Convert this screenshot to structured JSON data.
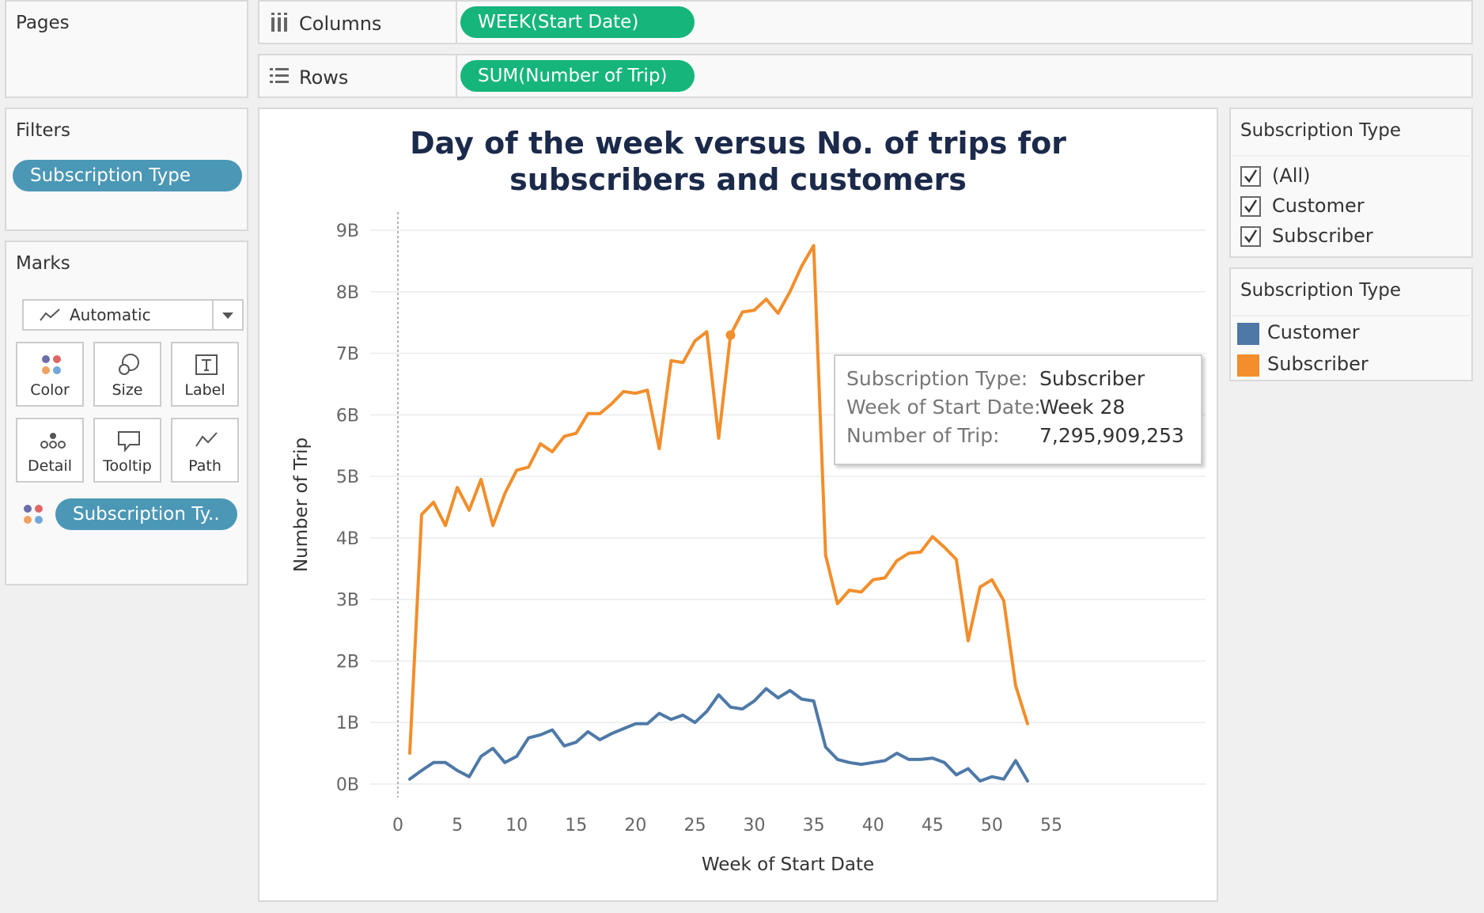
{
  "shelves": {
    "pages_label": "Pages",
    "columns_label": "Columns",
    "columns_pill": "WEEK(Start Date)",
    "rows_label": "Rows",
    "rows_pill": "SUM(Number of Trip)"
  },
  "filters": {
    "title": "Filters",
    "pill": "Subscription Type"
  },
  "marks": {
    "title": "Marks",
    "type": "Automatic",
    "buttons": {
      "color": "Color",
      "size": "Size",
      "label": "Label",
      "detail": "Detail",
      "tooltip": "Tooltip",
      "path": "Path"
    },
    "color_pill": "Subscription Ty.."
  },
  "filter_card": {
    "title": "Subscription Type",
    "options": [
      "(All)",
      "Customer",
      "Subscriber"
    ]
  },
  "legend": {
    "title": "Subscription Type",
    "items": [
      {
        "label": "Customer",
        "color": "#4e79a7"
      },
      {
        "label": "Subscriber",
        "color": "#f28e2b"
      }
    ]
  },
  "tooltip": {
    "k1": "Subscription Type:",
    "v1": "Subscriber",
    "k2": "Week of Start Date:",
    "v2": "Week 28",
    "k3": "Number of Trip:",
    "v3": "7,295,909,253"
  },
  "chart_data": {
    "type": "line",
    "title": "Day of the week versus No. of trips for subscribers and customers",
    "xlabel": "Week of Start Date",
    "ylabel": "Number of Trip",
    "xlim": [
      0,
      55
    ],
    "ylim": [
      0,
      9
    ],
    "xticks": [
      0,
      5,
      10,
      15,
      20,
      25,
      30,
      35,
      40,
      45,
      50,
      55
    ],
    "yticks": [
      0,
      1,
      2,
      3,
      4,
      5,
      6,
      7,
      8,
      9
    ],
    "ytick_labels": [
      "0B",
      "1B",
      "2B",
      "3B",
      "4B",
      "5B",
      "6B",
      "7B",
      "8B",
      "9B"
    ],
    "y_unit": "billions",
    "grid": "horizontal",
    "x": [
      1,
      2,
      3,
      4,
      5,
      6,
      7,
      8,
      9,
      10,
      11,
      12,
      13,
      14,
      15,
      16,
      17,
      18,
      19,
      20,
      21,
      22,
      23,
      24,
      25,
      26,
      27,
      28,
      29,
      30,
      31,
      32,
      33,
      34,
      35,
      36,
      37,
      38,
      39,
      40,
      41,
      42,
      43,
      44,
      45,
      46,
      47,
      48,
      49,
      50,
      51,
      52,
      53
    ],
    "series": [
      {
        "name": "Subscriber",
        "color": "#f28e2b",
        "values": [
          0.5,
          4.38,
          4.58,
          4.2,
          4.82,
          4.45,
          4.95,
          4.2,
          4.72,
          5.1,
          5.15,
          5.53,
          5.4,
          5.65,
          5.7,
          6.02,
          6.02,
          6.18,
          6.38,
          6.35,
          6.4,
          5.45,
          6.88,
          6.85,
          7.2,
          7.35,
          5.62,
          7.3,
          7.67,
          7.7,
          7.88,
          7.65,
          8.0,
          8.42,
          8.75,
          3.72,
          2.93,
          3.15,
          3.12,
          3.32,
          3.35,
          3.63,
          3.75,
          3.77,
          4.02,
          3.85,
          3.65,
          2.33,
          3.2,
          3.32,
          2.98,
          1.6,
          0.98
        ]
      },
      {
        "name": "Customer",
        "color": "#4e79a7",
        "values": [
          0.08,
          0.22,
          0.35,
          0.35,
          0.22,
          0.12,
          0.45,
          0.58,
          0.35,
          0.45,
          0.75,
          0.8,
          0.88,
          0.62,
          0.68,
          0.85,
          0.72,
          0.82,
          0.9,
          0.98,
          0.98,
          1.15,
          1.05,
          1.12,
          1.0,
          1.18,
          1.45,
          1.25,
          1.22,
          1.35,
          1.55,
          1.4,
          1.52,
          1.38,
          1.35,
          0.6,
          0.4,
          0.35,
          0.32,
          0.35,
          0.38,
          0.5,
          0.4,
          0.4,
          0.42,
          0.35,
          0.15,
          0.25,
          0.05,
          0.12,
          0.08,
          0.38,
          0.05
        ]
      }
    ],
    "highlight": {
      "series": "Subscriber",
      "x": 28,
      "y": 7.295909253
    }
  }
}
